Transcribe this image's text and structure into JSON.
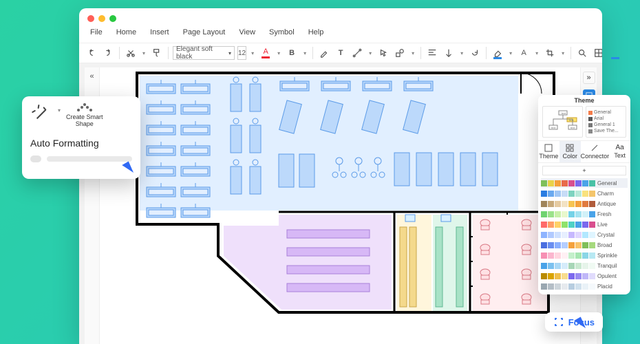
{
  "menu": {
    "file": "File",
    "home": "Home",
    "insert": "Insert",
    "page_layout": "Page Layout",
    "view": "View",
    "symbol": "Symbol",
    "help": "Help"
  },
  "toolbar": {
    "font_name": "Elegant soft black",
    "font_size": "12",
    "bold": "B",
    "format_letter": "A",
    "text_T": "T"
  },
  "auto_format": {
    "create_smart_shape": "Create Smart\nShape",
    "title": "Auto Formatting"
  },
  "focus": {
    "label": "Focus"
  },
  "theme": {
    "title": "Theme",
    "tabs": {
      "theme": "Theme",
      "color": "Color",
      "connector": "Connector",
      "text": "Text"
    },
    "add": "+",
    "preview_rows": [
      {
        "label": "General",
        "color": "#f47c4a"
      },
      {
        "label": "Arial",
        "color": "#555"
      },
      {
        "label": "General 1",
        "color": "#777"
      },
      {
        "label": "Save The...",
        "color": "#888"
      }
    ],
    "swatch_rows": [
      {
        "label": "General",
        "selected": true,
        "colors": [
          "#7fbf5a",
          "#e9d24a",
          "#f4a13c",
          "#e86a4a",
          "#d94f8e",
          "#7b68ee",
          "#4aa3e8",
          "#49c1a6"
        ]
      },
      {
        "label": "Charm",
        "selected": false,
        "colors": [
          "#2a7de1",
          "#6aa9ef",
          "#a1c7f5",
          "#c7dcf7",
          "#7dd3c0",
          "#b8e9d9",
          "#f9e27d",
          "#f4c56b"
        ]
      },
      {
        "label": "Antique",
        "selected": false,
        "colors": [
          "#a0855b",
          "#c7a97a",
          "#e5caa0",
          "#f2e2c4",
          "#f6c453",
          "#f4a13c",
          "#e07a3f",
          "#b05c3b"
        ]
      },
      {
        "label": "Fresh",
        "selected": false,
        "colors": [
          "#6fd36f",
          "#9be28a",
          "#c8f0a8",
          "#e8f8cc",
          "#74d2e7",
          "#a4e3f1",
          "#d1f1f8",
          "#4aa3e8"
        ]
      },
      {
        "label": "Live",
        "selected": false,
        "colors": [
          "#ff6b6b",
          "#ff9f68",
          "#ffd166",
          "#8ee26b",
          "#4fd1c5",
          "#4aa3e8",
          "#7b68ee",
          "#d94f8e"
        ]
      },
      {
        "label": "Crystal",
        "selected": false,
        "colors": [
          "#8fb4ff",
          "#b1caff",
          "#cfe0ff",
          "#e7efff",
          "#c7b8ff",
          "#e0d6ff",
          "#b1e8ff",
          "#dff5ff"
        ]
      },
      {
        "label": "Broad",
        "selected": false,
        "colors": [
          "#4a6ee0",
          "#6a8ef0",
          "#8cb0ff",
          "#b4cdff",
          "#f4a13c",
          "#f9c46b",
          "#7fbf5a",
          "#a6d97e"
        ]
      },
      {
        "label": "Sprinkle",
        "selected": false,
        "colors": [
          "#f78fb3",
          "#fbb6ce",
          "#ffd6e0",
          "#fff0f4",
          "#c3f0ca",
          "#a6e6b1",
          "#8ad6e6",
          "#b8e9f3"
        ]
      },
      {
        "label": "Tranquil",
        "selected": false,
        "colors": [
          "#4aa3e8",
          "#7bc1ef",
          "#aad9f6",
          "#d5ecfb",
          "#a7d6b7",
          "#cae9d1",
          "#e6f4ea",
          "#f0faf3"
        ]
      },
      {
        "label": "Opulent",
        "selected": false,
        "colors": [
          "#b98b00",
          "#d9a300",
          "#f0c04d",
          "#f8dc8e",
          "#7b68ee",
          "#9a8cf2",
          "#c0b7f8",
          "#e0dbfc"
        ]
      },
      {
        "label": "Placid",
        "selected": false,
        "colors": [
          "#9aa7b0",
          "#b4bec6",
          "#cdd5db",
          "#e6eaee",
          "#b7cde0",
          "#d1e1ee",
          "#eaf2f8",
          "#f5f9fc"
        ]
      }
    ]
  }
}
